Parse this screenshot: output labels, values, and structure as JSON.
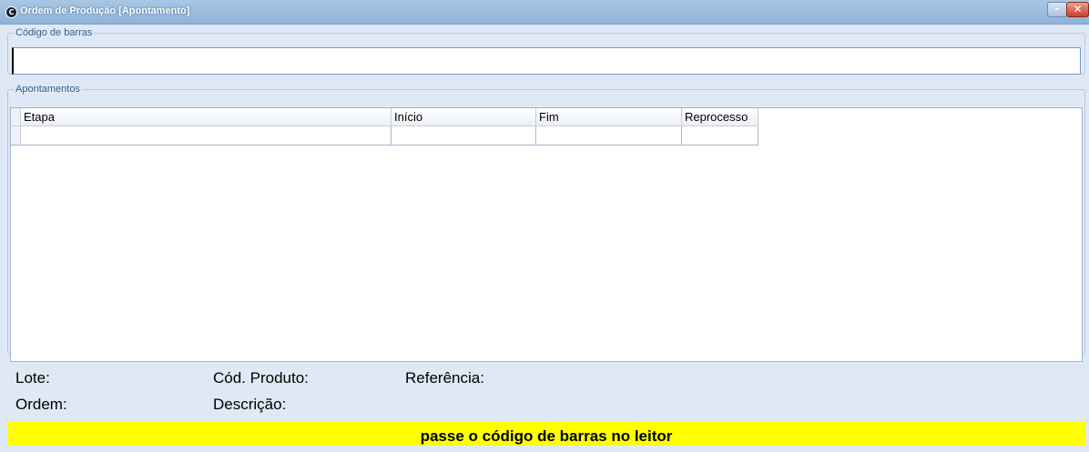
{
  "window": {
    "title": "Ordem de Produção [Apontamento]",
    "app_icon": "app-logo-icon",
    "minimize_glyph": "–",
    "close_glyph": "✕"
  },
  "barcode_group": {
    "legend": "Código de barras",
    "value": ""
  },
  "apontamentos_group": {
    "legend": "Apontamentos",
    "columns": [
      "Etapa",
      "Início",
      "Fim",
      "Reprocesso"
    ],
    "rows": [
      [
        "",
        "",
        "",
        ""
      ]
    ]
  },
  "info": {
    "lote_label": "Lote:",
    "ordem_label": "Ordem:",
    "cod_produto_label": "Cód. Produto:",
    "descricao_label": "Descrição:",
    "referencia_label": "Referência:"
  },
  "status_message": "passe o código de barras no leitor",
  "colors": {
    "banner": "#ffff00",
    "window_background": "#dfe9f5",
    "titlebar": "#9bbbe0"
  }
}
